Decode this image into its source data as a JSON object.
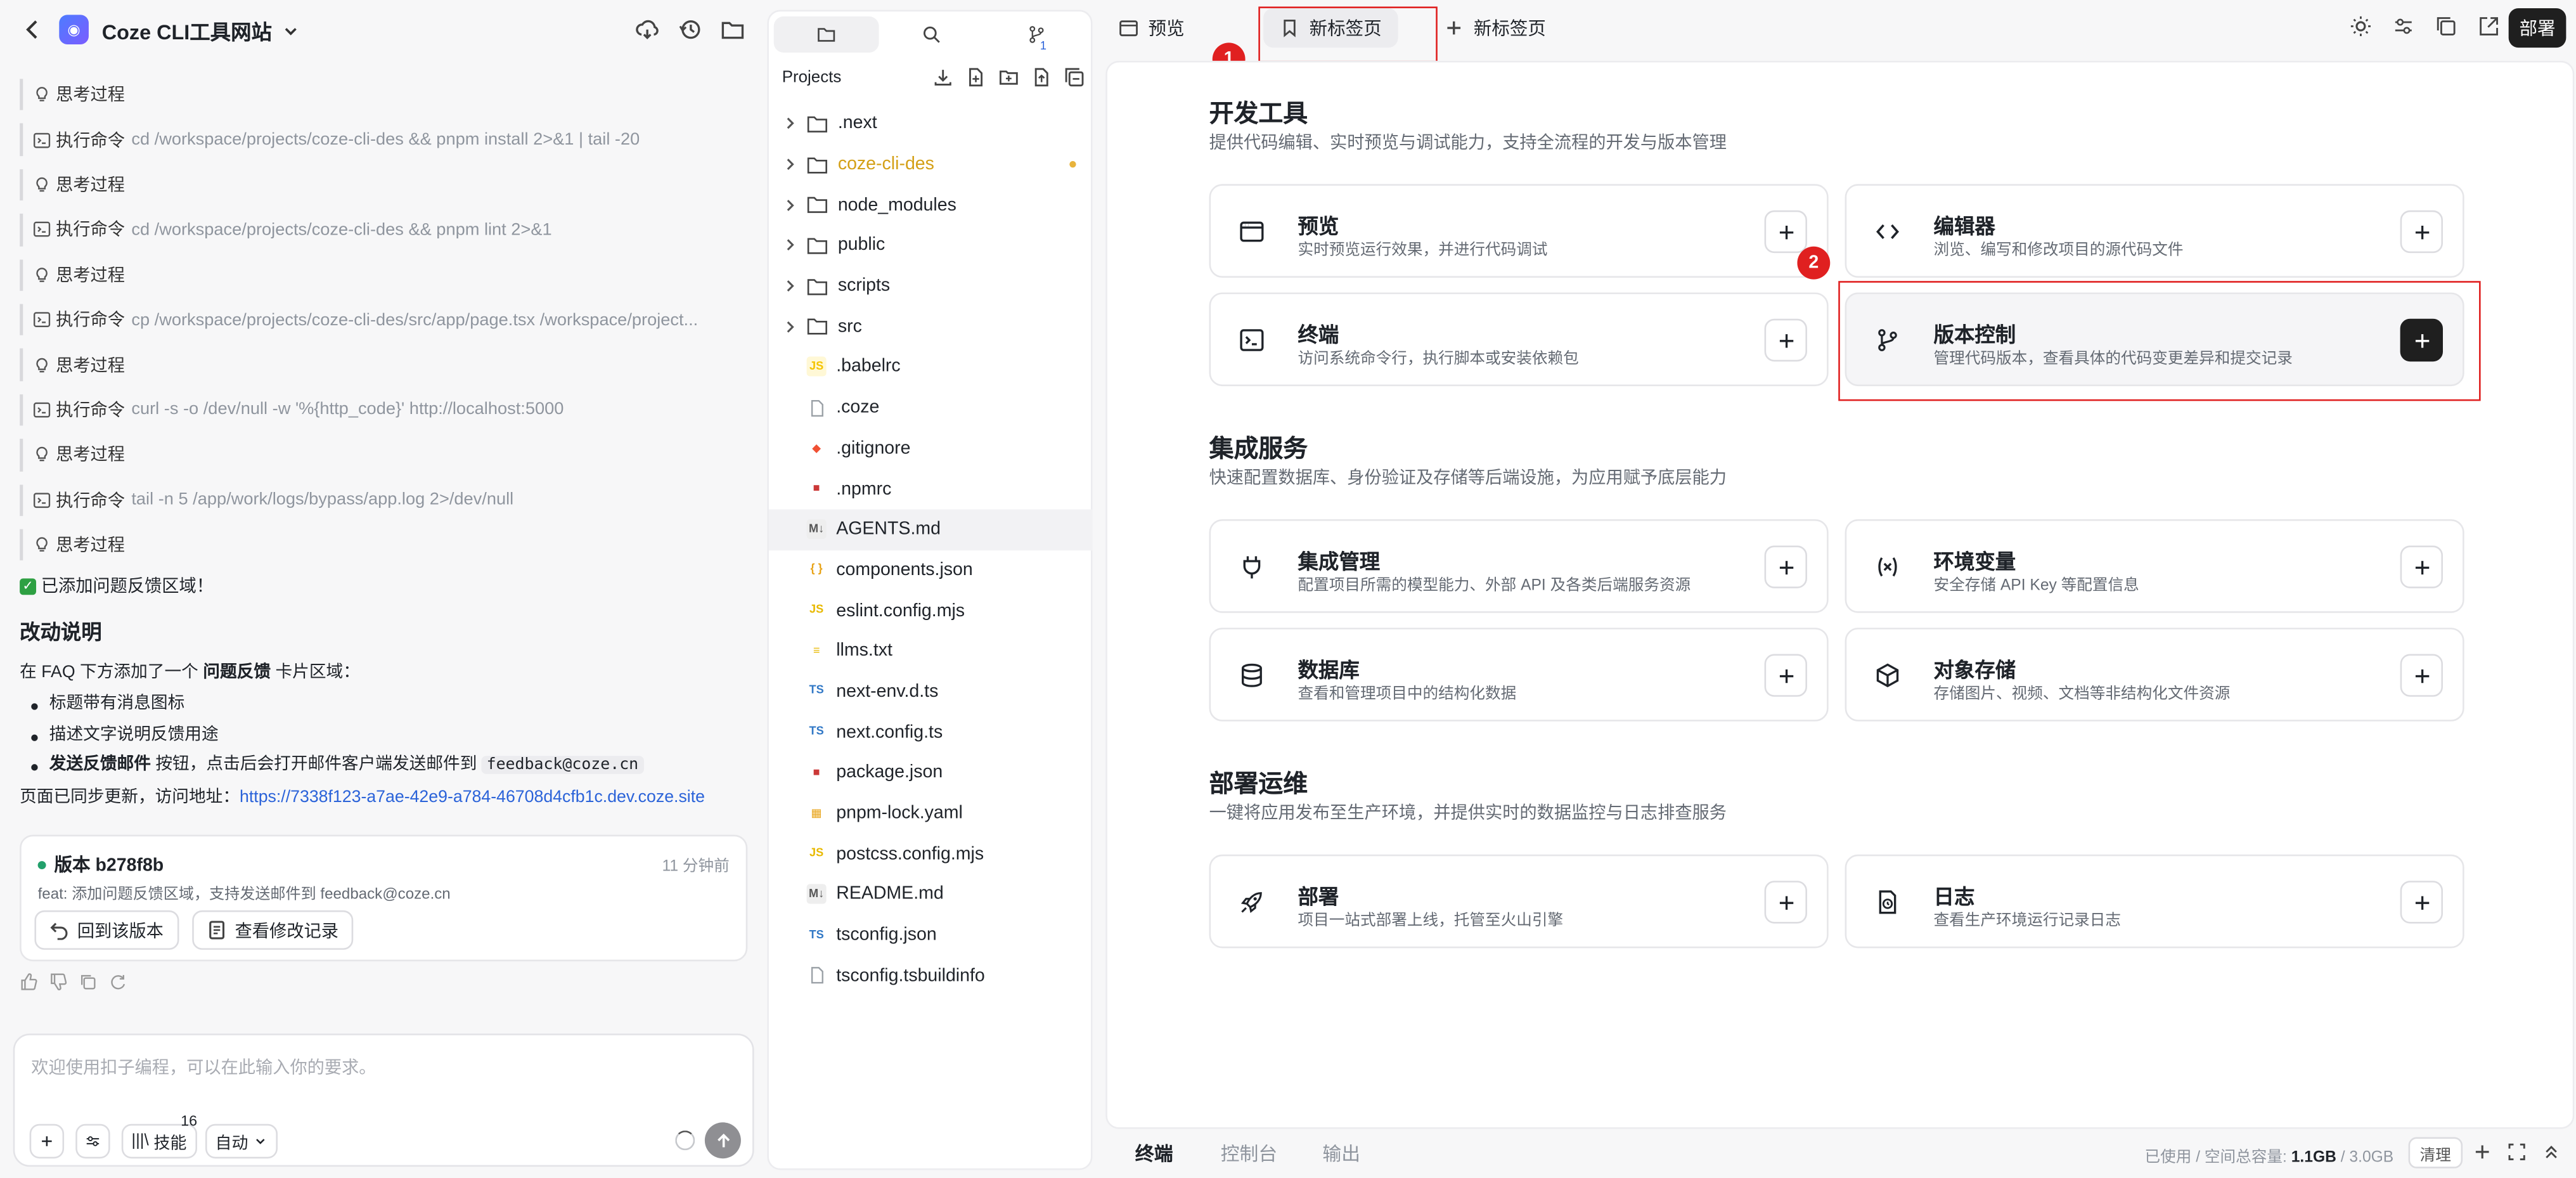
{
  "chat": {
    "project_title": "Coze CLI工具网站",
    "steps": [
      {
        "kind": "think",
        "label": "思考过程",
        "cmd": ""
      },
      {
        "kind": "exec",
        "label": "执行命令",
        "cmd": "cd /workspace/projects/coze-cli-des && pnpm install 2>&1 | tail -20"
      },
      {
        "kind": "think",
        "label": "思考过程",
        "cmd": ""
      },
      {
        "kind": "exec",
        "label": "执行命令",
        "cmd": "cd /workspace/projects/coze-cli-des && pnpm lint 2>&1"
      },
      {
        "kind": "think",
        "label": "思考过程",
        "cmd": ""
      },
      {
        "kind": "exec",
        "label": "执行命令",
        "cmd": "cp /workspace/projects/coze-cli-des/src/app/page.tsx /workspace/project..."
      },
      {
        "kind": "think",
        "label": "思考过程",
        "cmd": ""
      },
      {
        "kind": "exec",
        "label": "执行命令",
        "cmd": "curl -s -o /dev/null -w '%{http_code}' http://localhost:5000"
      },
      {
        "kind": "think",
        "label": "思考过程",
        "cmd": ""
      },
      {
        "kind": "exec",
        "label": "执行命令",
        "cmd": "tail -n 5 /app/work/logs/bypass/app.log 2>/dev/null"
      },
      {
        "kind": "think",
        "label": "思考过程",
        "cmd": ""
      }
    ],
    "done_line": "已添加问题反馈区域！",
    "change_heading": "改动说明",
    "change_intro_pre": "在 FAQ 下方添加了一个",
    "change_intro_bold": "问题反馈",
    "change_intro_post": "卡片区域：",
    "bullet_1": "标题带有消息图标",
    "bullet_2": "描述文字说明反馈用途",
    "bullet_3_bold": "发送反馈邮件",
    "bullet_3_text": "按钮，点击后会打开邮件客户端发送邮件到",
    "bullet_3_code": "feedback@coze.cn",
    "sync_text": "页面已同步更新，访问地址：",
    "sync_link": "https://7338f123-a7ae-42e9-a784-46708d4cfb1c.dev.coze.site",
    "version_card": {
      "title": "版本 b278f8b",
      "time": "11 分钟前",
      "desc": "feat: 添加问题反馈区域，支持发送邮件到 feedback@coze.cn",
      "rollback_label": "回到该版本",
      "view_changes_label": "查看修改记录"
    },
    "composer": {
      "placeholder": "欢迎使用扣子编程，可以在此输入你的要求。",
      "skills_label": "技能",
      "skills_count": "16",
      "mode_label": "自动"
    }
  },
  "explorer": {
    "section_label": "Projects",
    "nodes": [
      {
        "name": ".next",
        "type": "folder"
      },
      {
        "name": "coze-cli-des",
        "type": "folder",
        "modified": true
      },
      {
        "name": "node_modules",
        "type": "folder"
      },
      {
        "name": "public",
        "type": "folder"
      },
      {
        "name": "scripts",
        "type": "folder"
      },
      {
        "name": "src",
        "type": "folder"
      },
      {
        "name": ".babelrc",
        "type": "babel"
      },
      {
        "name": ".coze",
        "type": "file"
      },
      {
        "name": ".gitignore",
        "type": "git"
      },
      {
        "name": ".npmrc",
        "type": "npm"
      },
      {
        "name": "AGENTS.md",
        "type": "md",
        "selected": true
      },
      {
        "name": "components.json",
        "type": "json"
      },
      {
        "name": "eslint.config.mjs",
        "type": "js"
      },
      {
        "name": "llms.txt",
        "type": "txt"
      },
      {
        "name": "next-env.d.ts",
        "type": "ts"
      },
      {
        "name": "next.config.ts",
        "type": "ts"
      },
      {
        "name": "package.json",
        "type": "npm"
      },
      {
        "name": "pnpm-lock.yaml",
        "type": "yaml"
      },
      {
        "name": "postcss.config.mjs",
        "type": "js"
      },
      {
        "name": "README.md",
        "type": "md"
      },
      {
        "name": "tsconfig.json",
        "type": "tsjson"
      },
      {
        "name": "tsconfig.tsbuildinfo",
        "type": "file"
      }
    ],
    "git_badge": "1"
  },
  "topbar": {
    "tab_preview": "预览",
    "tab_new_active": "新标签页",
    "tab_new_add": "新标签页",
    "deploy_label": "部署",
    "annotation_1": "1",
    "annotation_2": "2"
  },
  "main": {
    "sections": [
      {
        "title": "开发工具",
        "subtitle": "提供代码编辑、实时预览与调试能力，支持全流程的开发与版本管理",
        "cards": [
          {
            "title": "预览",
            "desc": "实时预览运行效果，并进行代码调试",
            "icon": "browser-window-icon"
          },
          {
            "title": "编辑器",
            "desc": "浏览、编写和修改项目的源代码文件",
            "icon": "code-brackets-icon"
          },
          {
            "title": "终端",
            "desc": "访问系统命令行，执行脚本或安装依赖包",
            "icon": "terminal-icon"
          },
          {
            "title": "版本控制",
            "desc": "管理代码版本，查看具体的代码变更差异和提交记录",
            "icon": "git-branch-icon",
            "highlighted": true
          }
        ]
      },
      {
        "title": "集成服务",
        "subtitle": "快速配置数据库、身份验证及存储等后端设施，为应用赋予底层能力",
        "cards": [
          {
            "title": "集成管理",
            "desc": "配置项目所需的模型能力、外部 API 及各类后端服务资源",
            "icon": "plug-icon"
          },
          {
            "title": "环境变量",
            "desc": "安全存储 API Key 等配置信息",
            "icon": "variable-icon"
          },
          {
            "title": "数据库",
            "desc": "查看和管理项目中的结构化数据",
            "icon": "database-icon"
          },
          {
            "title": "对象存储",
            "desc": "存储图片、视频、文档等非结构化文件资源",
            "icon": "cube-icon"
          }
        ]
      },
      {
        "title": "部署运维",
        "subtitle": "一键将应用发布至生产环境，并提供实时的数据监控与日志排查服务",
        "cards": [
          {
            "title": "部署",
            "desc": "项目一站式部署上线，托管至火山引擎",
            "icon": "rocket-icon"
          },
          {
            "title": "日志",
            "desc": "查看生产环境运行记录日志",
            "icon": "log-file-icon"
          }
        ]
      }
    ]
  },
  "bottombar": {
    "tab_terminal": "终端",
    "tab_console": "控制台",
    "tab_output": "输出",
    "storage_label": "已使用 / 空间总容量:",
    "storage_used": "1.1GB",
    "storage_total": "/ 3.0GB",
    "clear_label": "清理"
  }
}
